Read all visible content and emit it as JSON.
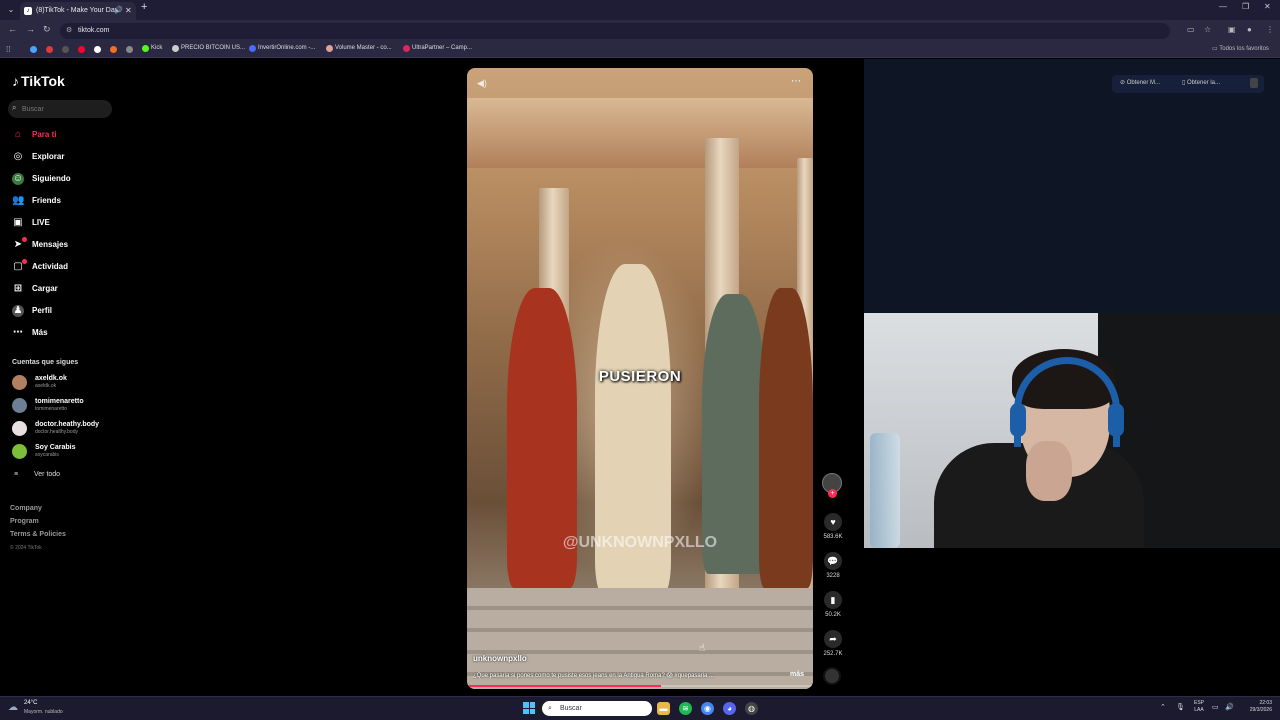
{
  "browser": {
    "tab_title": "(8)TikTok - Make Your Day",
    "url": "tiktok.com",
    "bookmarks": [
      {
        "label": "Kick",
        "color": "#53fc18"
      },
      {
        "label": "PRECIO BITCOIN US...",
        "color": "#cccccc"
      },
      {
        "label": "InvertirOnline.com -...",
        "color": "#4a6cf7"
      },
      {
        "label": "Volume Master - co...",
        "color": "#e0a0a0"
      },
      {
        "label": "UltraPartner – Camp...",
        "color": "#e0245e"
      }
    ],
    "all_bookmarks": "Todos los favoritos"
  },
  "tiktok": {
    "logo": "TikTok",
    "search_placeholder": "Buscar",
    "nav": [
      {
        "label": "Para ti",
        "icon": "home-icon",
        "active": true
      },
      {
        "label": "Explorar",
        "icon": "compass-icon"
      },
      {
        "label": "Siguiendo",
        "icon": "following-icon"
      },
      {
        "label": "Friends",
        "icon": "friends-icon"
      },
      {
        "label": "LIVE",
        "icon": "live-icon"
      },
      {
        "label": "Mensajes",
        "icon": "messages-icon"
      },
      {
        "label": "Actividad",
        "icon": "activity-icon"
      },
      {
        "label": "Cargar",
        "icon": "upload-icon"
      },
      {
        "label": "Perfil",
        "icon": "profile-icon"
      },
      {
        "label": "Más",
        "icon": "more-icon"
      }
    ],
    "following_title": "Cuentas que sigues",
    "following": [
      {
        "name": "axeldk.ok",
        "handle": "axeldk.ok",
        "color": "#b08060"
      },
      {
        "name": "tomimenaretto",
        "handle": "tomimenaretto",
        "color": "#6d7f93"
      },
      {
        "name": "doctor.heathy.body",
        "handle": "doctor.healthy.body",
        "color": "#e8e0e0"
      },
      {
        "name": "Soy Carabis",
        "handle": "soycarabis",
        "color": "#7cbf3a"
      }
    ],
    "see_all": "Ver todo",
    "footer": [
      "Company",
      "Program",
      "Terms & Policies"
    ],
    "copyright": "© 2024 TikTok",
    "video": {
      "caption_word": "PUSIERON",
      "watermark": "@UNKNOWNPXLLO",
      "author": "unknownpxllo",
      "description": "¿Que pasaria si pones como te pusiste esos jeans en la Antigua Roma? 😱 #quepasaria ...",
      "more": "más",
      "progress": 0.56
    },
    "actions": {
      "likes": "583.6K",
      "comments": "3228",
      "saves": "50.2K",
      "shares": "252.7K"
    }
  },
  "extension": {
    "btn1": "Obtener M...",
    "btn2": "Obtener la..."
  },
  "taskbar": {
    "temp": "24°C",
    "weather": "Mayorm. nublado",
    "search": "Buscar",
    "lang_top": "ESP",
    "lang_bottom": "LAA",
    "time": "22:03",
    "date": "29/3/2026"
  }
}
